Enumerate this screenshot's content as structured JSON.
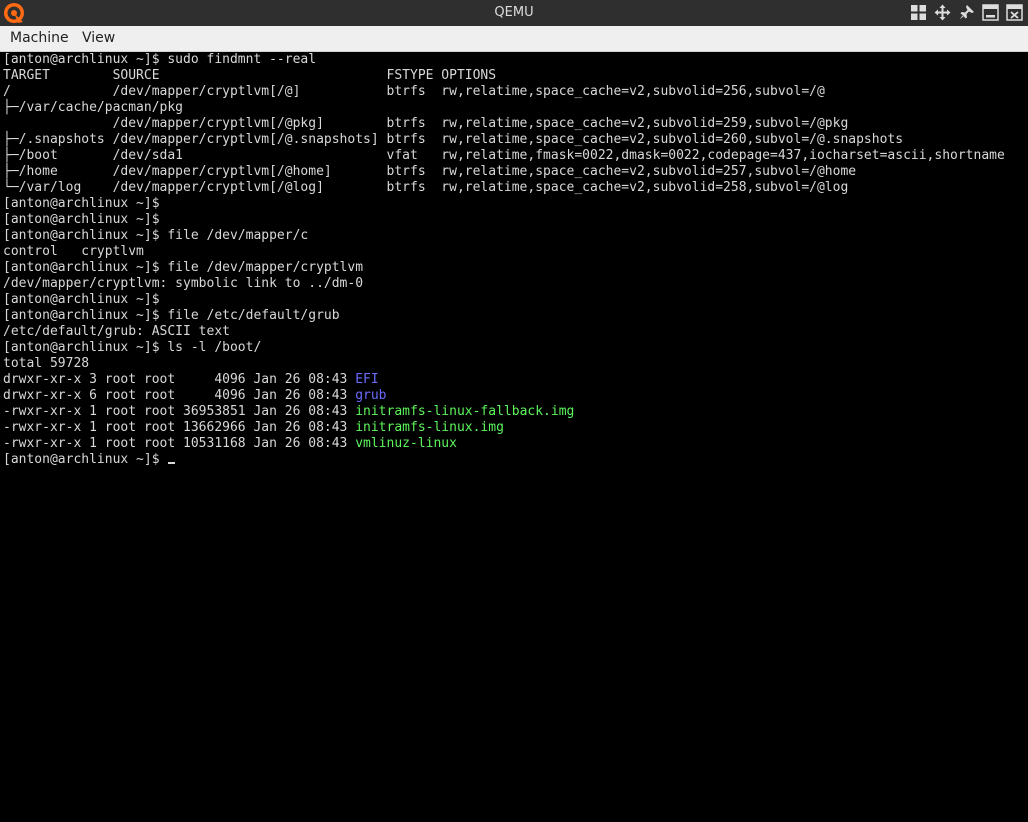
{
  "window": {
    "title": "QEMU",
    "icon": "qemu-logo-icon"
  },
  "window_buttons": [
    {
      "name": "tile-icon"
    },
    {
      "name": "move-icon"
    },
    {
      "name": "pin-icon"
    },
    {
      "name": "minimize-icon"
    },
    {
      "name": "close-icon"
    }
  ],
  "menu": {
    "machine": "Machine",
    "view": "View"
  },
  "terminal": {
    "colors": {
      "text": "#d8d8d8",
      "directory": "#6b6bff",
      "executable": "#5cf55c",
      "background": "#000000"
    },
    "lines": [
      {
        "text": "[anton@archlinux ~]$ sudo findmnt --real"
      },
      {
        "text": "TARGET        SOURCE                             FSTYPE OPTIONS"
      },
      {
        "text": "/             /dev/mapper/cryptlvm[/@]           btrfs  rw,relatime,space_cache=v2,subvolid=256,subvol=/@"
      },
      {
        "text": "├─/var/cache/pacman/pkg"
      },
      {
        "text": "              /dev/mapper/cryptlvm[/@pkg]        btrfs  rw,relatime,space_cache=v2,subvolid=259,subvol=/@pkg"
      },
      {
        "text": "├─/.snapshots /dev/mapper/cryptlvm[/@.snapshots] btrfs  rw,relatime,space_cache=v2,subvolid=260,subvol=/@.snapshots"
      },
      {
        "text": "├─/boot       /dev/sda1                          vfat   rw,relatime,fmask=0022,dmask=0022,codepage=437,iocharset=ascii,shortname"
      },
      {
        "text": "├─/home       /dev/mapper/cryptlvm[/@home]       btrfs  rw,relatime,space_cache=v2,subvolid=257,subvol=/@home"
      },
      {
        "text": "└─/var/log    /dev/mapper/cryptlvm[/@log]        btrfs  rw,relatime,space_cache=v2,subvolid=258,subvol=/@log"
      },
      {
        "text": "[anton@archlinux ~]$"
      },
      {
        "text": "[anton@archlinux ~]$"
      },
      {
        "text": "[anton@archlinux ~]$ file /dev/mapper/c"
      },
      {
        "text": "control   cryptlvm"
      },
      {
        "text": "[anton@archlinux ~]$ file /dev/mapper/cryptlvm"
      },
      {
        "text": "/dev/mapper/cryptlvm: symbolic link to ../dm-0"
      },
      {
        "text": "[anton@archlinux ~]$"
      },
      {
        "text": "[anton@archlinux ~]$ file /etc/default/grub"
      },
      {
        "text": "/etc/default/grub: ASCII text"
      },
      {
        "text": "[anton@archlinux ~]$ ls -l /boot/"
      },
      {
        "text": "total 59728"
      },
      {
        "text": "drwxr-xr-x 3 root root     4096 Jan 26 08:43 ",
        "name": "EFI",
        "kind": "directory"
      },
      {
        "text": "drwxr-xr-x 6 root root     4096 Jan 26 08:43 ",
        "name": "grub",
        "kind": "directory"
      },
      {
        "text": "-rwxr-xr-x 1 root root 36953851 Jan 26 08:43 ",
        "name": "initramfs-linux-fallback.img",
        "kind": "executable"
      },
      {
        "text": "-rwxr-xr-x 1 root root 13662966 Jan 26 08:43 ",
        "name": "initramfs-linux.img",
        "kind": "executable"
      },
      {
        "text": "-rwxr-xr-x 1 root root 10531168 Jan 26 08:43 ",
        "name": "vmlinuz-linux",
        "kind": "executable"
      },
      {
        "text": "[anton@archlinux ~]$ ",
        "cursor": true
      }
    ]
  }
}
